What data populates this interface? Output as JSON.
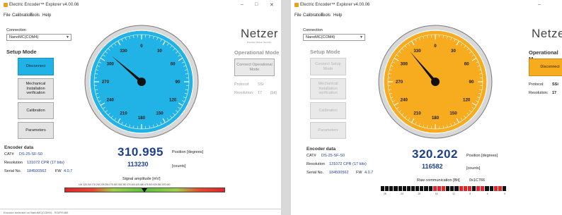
{
  "left": {
    "title": "Electric Encoder™ Explorer v4.00.06",
    "menu": [
      "File",
      "Calibration",
      "Tools",
      "Help"
    ],
    "connection_label": "Connection",
    "connection_value": "NanoMC(COM4)",
    "setup_title": "Setup Mode",
    "buttons": [
      "Disconnect",
      "Mechanical Installation verification",
      "Calibration",
      "Parameters"
    ],
    "op_title": "Operational Mode",
    "op_button": "Connect Operational Mode",
    "protocol_label": "Protocol:",
    "protocol_value": "SSi",
    "resolution_label": "Resolution:",
    "resolution_value": "17",
    "resolution_unit": "[bit]",
    "logo": "Netzer",
    "logo_sub": "Precision Motion Sensors",
    "dial_labels": [
      "0",
      "30",
      "60",
      "90",
      "120",
      "150",
      "180",
      "210",
      "240",
      "270",
      "300",
      "330"
    ],
    "encoder_title": "Encoder data",
    "cat_label": "CAT#",
    "cat_value": "DS-25-SF-S0",
    "res_label": "Resolution",
    "res_value": "131072 CPR (17 bits)",
    "serial_label": "Serial No.",
    "serial_value": "184500562",
    "fw_label": "FW",
    "fw_value": "4.0.7",
    "position_value": "310.995",
    "position_unit": "Position [degrees]",
    "counts_value": "113230",
    "counts_unit": "[counts]",
    "signal_label": "Signal amplitude [mV]",
    "signal_ticks": "100 125 150 175 200 225 250 275 300 325 350 375 400 425 450 475 500 525 550 575 600",
    "status": "Encoder detected on NanoMC(COM4) - SSI/RS485"
  },
  "right": {
    "title": "Electric Encoder™ Explorer v4.00.06",
    "menu": [
      "File",
      "Calibration",
      "Tools",
      "Help"
    ],
    "connection_label": "Connection",
    "connection_value": "NanoMC(COM4)",
    "setup_title": "Setup Mode",
    "buttons": [
      "Connect Setup Mode",
      "Mechanical Installation verification",
      "Calibration",
      "Parameters"
    ],
    "op_title": "Operational M",
    "op_button": "Disconnect",
    "protocol_label": "Protocol:",
    "protocol_value": "SSi",
    "resolution_label": "Resolution:",
    "resolution_value": "17",
    "logo": "Netze",
    "dial_labels": [
      "0",
      "30",
      "60",
      "90",
      "120",
      "150",
      "180",
      "210",
      "240",
      "270",
      "300",
      "330"
    ],
    "encoder_title": "Encoder data",
    "cat_label": "CAT#",
    "cat_value": "DS-25-SF-S0",
    "res_label": "Resolution",
    "res_value": "131072 CPR (17 bits)",
    "serial_label": "Serial No.",
    "serial_value": "184500562",
    "fw_label": "FW",
    "fw_value": "4.0.7",
    "position_value": "320.202",
    "position_unit": "Position [degrees]",
    "counts_value": "116582",
    "counts_unit": "[counts]",
    "raw_label": "Raw communication [Bit]",
    "raw_hex": "0x1C766",
    "raw_ticks": [
      "28",
      "24",
      "20",
      "16",
      "12",
      "8",
      "4",
      "0"
    ]
  },
  "colors": {
    "blue_accent": "#22b3e6",
    "orange_accent": "#f7ab1f",
    "value_text": "#1c3f8f"
  }
}
